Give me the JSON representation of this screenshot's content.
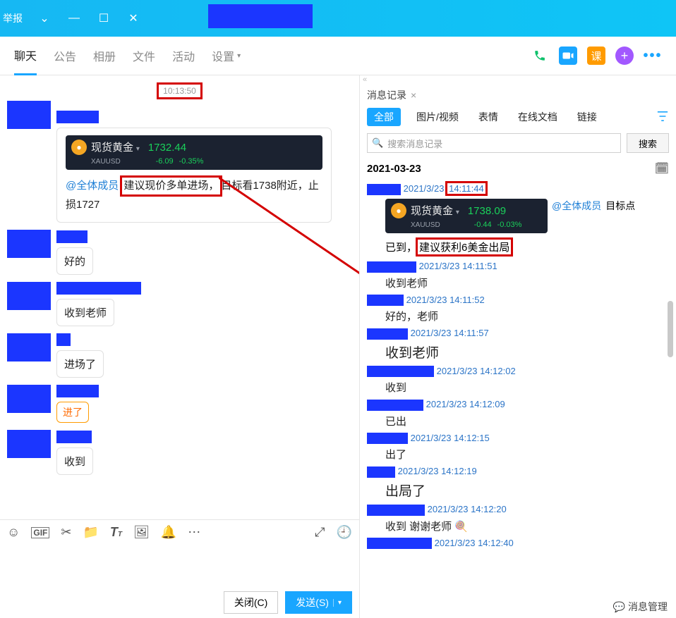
{
  "titlebar": {
    "report": "举报"
  },
  "tabs": {
    "chat": "聊天",
    "notice": "公告",
    "album": "相册",
    "files": "文件",
    "activity": "活动",
    "settings": "设置",
    "class_label": "课"
  },
  "chat": {
    "timestamp": "10:13:50",
    "quote1": {
      "name": "现货黄金",
      "symbol": "XAUUSD",
      "price": "1732.44",
      "chg": "-6.09",
      "pct": "-0.35%"
    },
    "mention_all": "@全体成员",
    "advice_hl": "建议现价多单进场，",
    "advice_rest": "目标看1738附近，止损1727",
    "r1": "好的",
    "r2": "收到老师",
    "r3": "进场了",
    "r4": "进了",
    "r5": "收到"
  },
  "compose": {
    "close": "关闭(C)",
    "send": "发送(S)"
  },
  "record": {
    "title": "消息记录",
    "tab_all": "全部",
    "tab_img": "图片/视频",
    "tab_emoji": "表情",
    "tab_docs": "在线文档",
    "tab_link": "链接",
    "search_ph": "搜索消息记录",
    "search_btn": "搜索",
    "date": "2021-03-23",
    "msg1": {
      "date": "2021/3/23",
      "time": "14:11:44",
      "quote": {
        "name": "现货黄金",
        "symbol": "XAUUSD",
        "price": "1738.09",
        "chg": "-0.44",
        "pct": "-0.03%"
      },
      "mention": "@全体成员",
      "after": "目标点",
      "line2a": "已到，",
      "line2_hl": "建议获利6美金出局"
    },
    "msg2": {
      "dt": "2021/3/23 14:11:51",
      "text": "收到老师"
    },
    "msg3": {
      "dt": "2021/3/23 14:11:52",
      "text": "好的，老师"
    },
    "msg4": {
      "dt": "2021/3/23 14:11:57",
      "text": "收到老师",
      "big": true
    },
    "msg5": {
      "dt": "2021/3/23 14:12:02",
      "text": "收到"
    },
    "msg6": {
      "dt": "2021/3/23 14:12:09",
      "text": "已出"
    },
    "msg7": {
      "dt": "2021/3/23 14:12:15",
      "text": "出了"
    },
    "msg8": {
      "dt": "2021/3/23 14:12:19",
      "text": "出局了",
      "big": true
    },
    "msg9": {
      "dt": "2021/3/23 14:12:20",
      "text": "收到 谢谢老师",
      "emoji": "🍭"
    },
    "msg10": {
      "dt": "2021/3/23 14:12:40"
    },
    "manage": "消息管理"
  }
}
